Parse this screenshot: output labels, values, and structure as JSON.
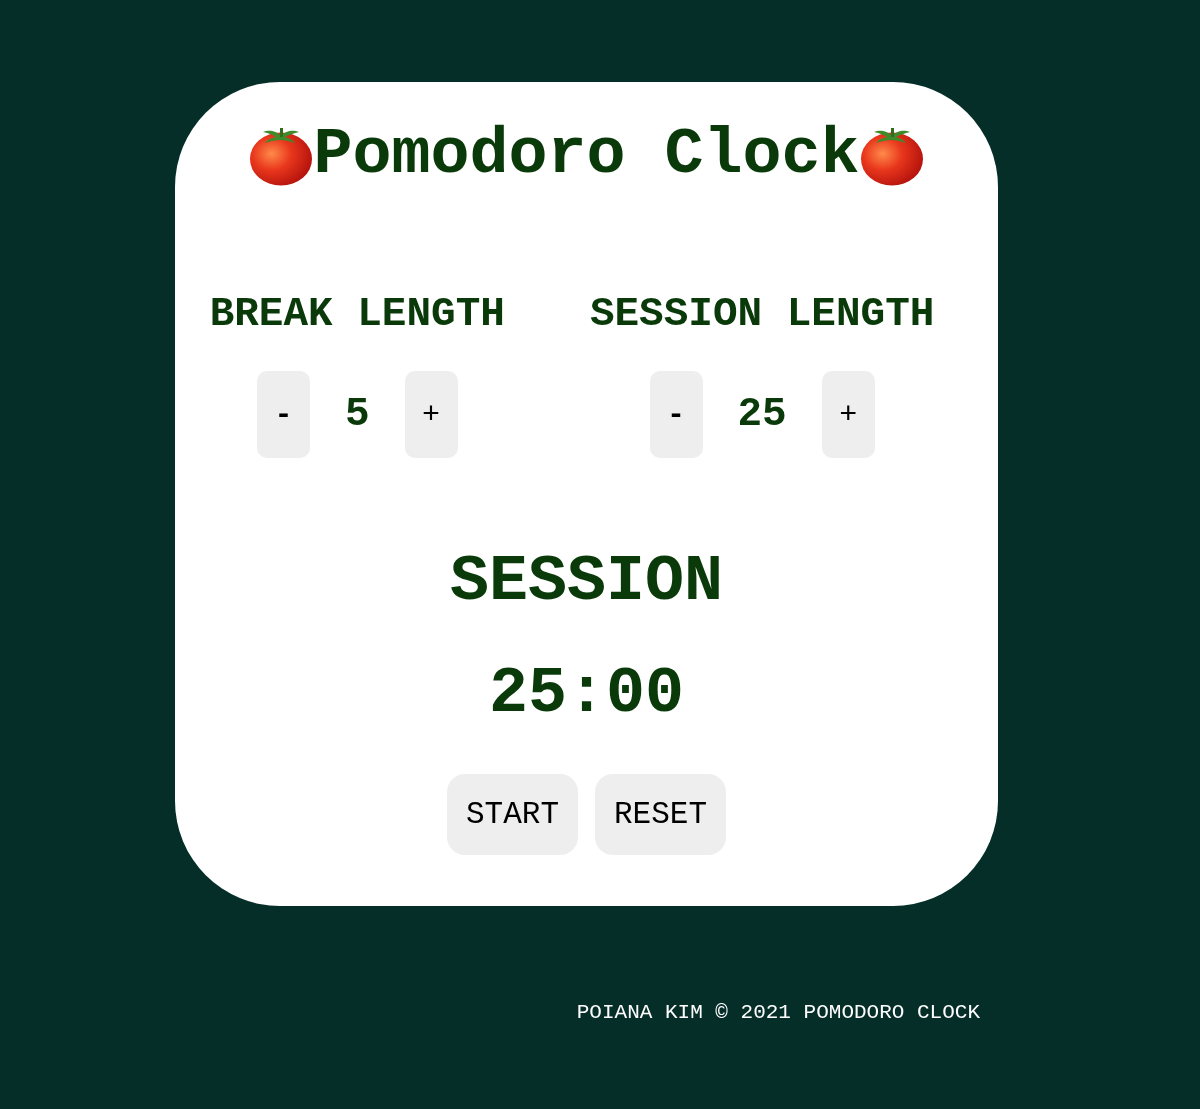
{
  "title": "Pomodoro Clock",
  "controls": [
    {
      "label": "BREAK LENGTH",
      "decrement": "-",
      "value": "5",
      "increment": "+"
    },
    {
      "label": "SESSION LENGTH",
      "decrement": "-",
      "value": "25",
      "increment": "+"
    }
  ],
  "timer": {
    "label": "SESSION",
    "time": "25:00"
  },
  "buttons": [
    "START",
    "RESET"
  ],
  "footer": "POIANA KIM © 2021 POMODORO CLOCK"
}
